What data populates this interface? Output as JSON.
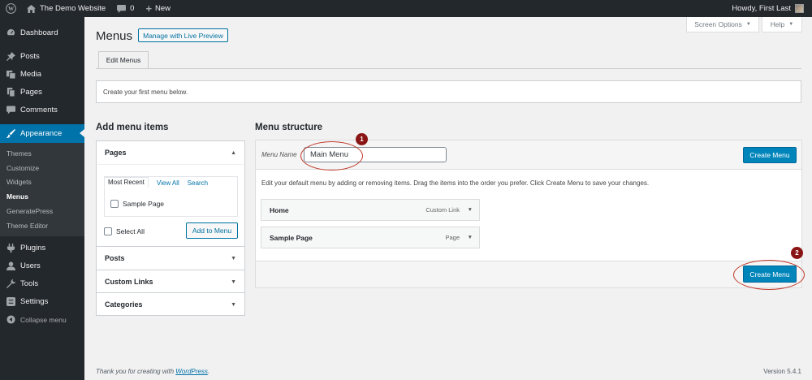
{
  "admin_bar": {
    "site_name": "The Demo Website",
    "comments_count": "0",
    "new_label": "New",
    "greeting": "Howdy, First Last"
  },
  "sidebar": {
    "items": [
      {
        "label": "Dashboard",
        "icon": "dashboard-icon"
      },
      {
        "label": "Posts",
        "icon": "pin-icon"
      },
      {
        "label": "Media",
        "icon": "media-icon"
      },
      {
        "label": "Pages",
        "icon": "pages-icon"
      },
      {
        "label": "Comments",
        "icon": "comment-icon"
      },
      {
        "label": "Appearance",
        "icon": "brush-icon"
      }
    ],
    "submenu": [
      "Themes",
      "Customize",
      "Widgets",
      "Menus",
      "GeneratePress",
      "Theme Editor"
    ],
    "lower_items": [
      {
        "label": "Plugins",
        "icon": "plugin-icon"
      },
      {
        "label": "Users",
        "icon": "user-icon"
      },
      {
        "label": "Tools",
        "icon": "wrench-icon"
      },
      {
        "label": "Settings",
        "icon": "settings-icon"
      }
    ],
    "collapse_label": "Collapse menu"
  },
  "screen_meta": {
    "screen_options": "Screen Options",
    "help": "Help"
  },
  "header": {
    "title": "Menus",
    "live_preview": "Manage with Live Preview",
    "tab_edit": "Edit Menus"
  },
  "notice": "Create your first menu below.",
  "left": {
    "heading": "Add menu items",
    "pages_heading": "Pages",
    "tabs": [
      "Most Recent",
      "View All",
      "Search"
    ],
    "page_item": "Sample Page",
    "select_all": "Select All",
    "add_to_menu": "Add to Menu",
    "sections": [
      "Posts",
      "Custom Links",
      "Categories"
    ]
  },
  "right": {
    "heading": "Menu structure",
    "menu_name_label": "Menu Name",
    "menu_name_value": "Main Menu",
    "create_menu": "Create Menu",
    "instructions": "Edit your default menu by adding or removing items. Drag the items into the order you prefer. Click Create Menu to save your changes.",
    "items": [
      {
        "title": "Home",
        "type": "Custom Link"
      },
      {
        "title": "Sample Page",
        "type": "Page"
      }
    ]
  },
  "callouts": [
    "1",
    "2"
  ],
  "footer": {
    "thanks_prefix": "Thank you for creating with ",
    "thanks_link": "WordPress",
    "thanks_suffix": ".",
    "version": "Version 5.4.1"
  },
  "colors": {
    "admin_dark": "#23282d",
    "accent_blue": "#0073aa",
    "primary_button": "#0085ba",
    "callout_red": "#8a1515"
  }
}
